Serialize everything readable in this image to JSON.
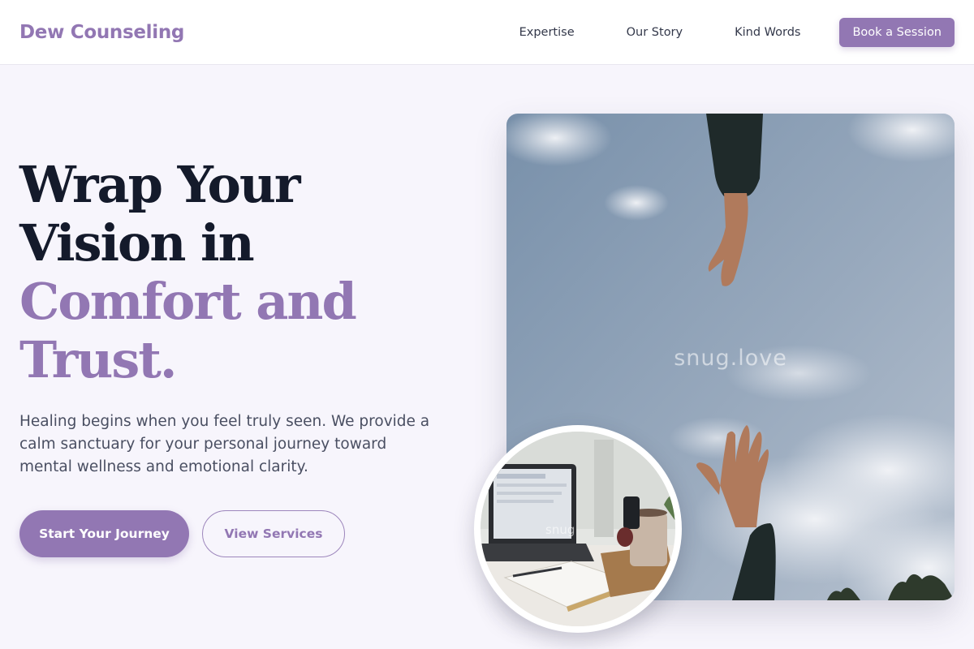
{
  "brand": {
    "name": "Dew Counseling"
  },
  "nav": {
    "links": [
      "Expertise",
      "Our Story",
      "Kind Words"
    ],
    "cta": "Book a Session"
  },
  "hero": {
    "headline_lines": [
      "Wrap Your",
      "Vision in"
    ],
    "headline_accent_lines": [
      "Comfort and",
      "Trust."
    ],
    "subtext": "Healing begins when you feel truly seen. We provide a calm sanctuary for your personal journey toward mental wellness and emotional clarity.",
    "primary_button": "Start Your Journey",
    "secondary_button": "View Services"
  },
  "images": {
    "main_watermark": "snug.love",
    "inset_watermark": "snug"
  },
  "colors": {
    "accent": "#9277b3",
    "heading": "#141a2b",
    "background": "#f7f5fc",
    "header_bg": "#ffffff"
  }
}
